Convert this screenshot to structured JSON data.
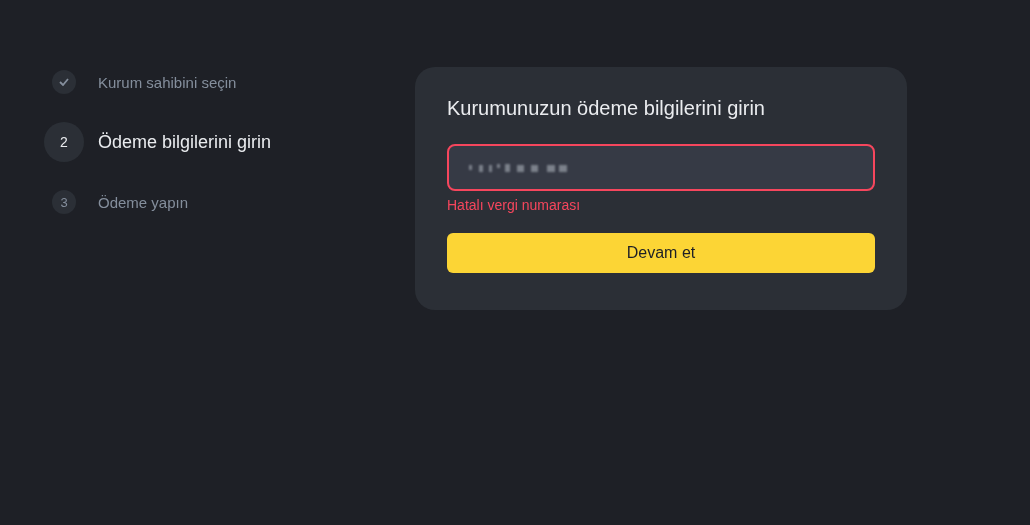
{
  "steps": [
    {
      "label": "Kurum sahibini seçin",
      "done": true,
      "selected": false
    },
    {
      "number": "2",
      "label": "Ödeme bilgilerini girin",
      "done": false,
      "selected": true
    },
    {
      "number": "3",
      "label": "Ödeme yapın",
      "done": false,
      "selected": false
    }
  ],
  "form": {
    "title": "Kurumunuzun ödeme bilgilerini girin",
    "field": {
      "invalid": true,
      "error": "Hatalı vergi numarası"
    },
    "button": "Devam et"
  }
}
